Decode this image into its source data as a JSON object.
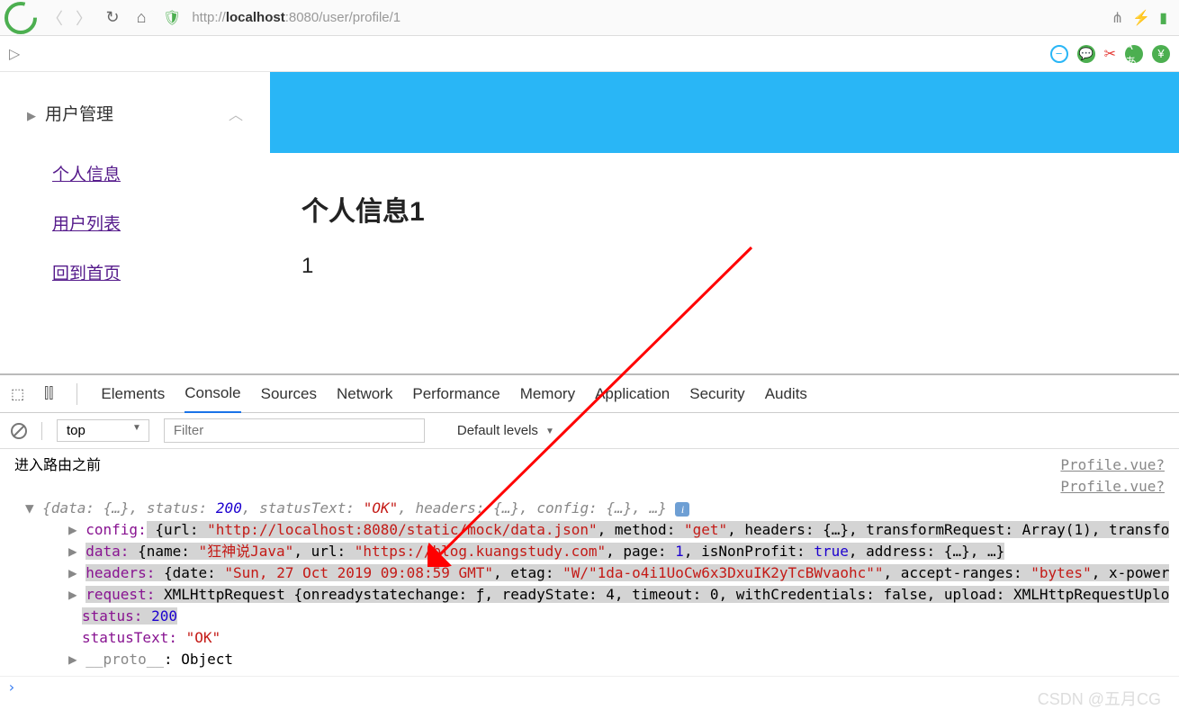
{
  "browser": {
    "url_host": "localhost",
    "url_port": ":8080",
    "url_path": "/user/profile/1"
  },
  "sidebar": {
    "header": "用户管理",
    "links": [
      "个人信息",
      "用户列表",
      "回到首页"
    ]
  },
  "main": {
    "title": "个人信息1",
    "value": "1"
  },
  "devtools": {
    "tabs": [
      "Elements",
      "Console",
      "Sources",
      "Network",
      "Performance",
      "Memory",
      "Application",
      "Security",
      "Audits"
    ],
    "active_tab": "Console",
    "context": "top",
    "filter_placeholder": "Filter",
    "levels": "Default levels"
  },
  "console": {
    "msg1": "进入路由之前",
    "source1": "Profile.vue?",
    "source2": "Profile.vue?",
    "summary_pre": "{data: {…}, status: ",
    "summary_status": "200",
    "summary_mid1": ", statusText: ",
    "summary_ok": "\"OK\"",
    "summary_rest": ", headers: {…}, config: {…}, …}",
    "config_key": "config:",
    "config_val_pre": " {url: ",
    "config_url": "\"http://localhost:8080/static/mock/data.json\"",
    "config_mid": ", method: ",
    "config_method": "\"get\"",
    "config_rest": ", headers: {…}, transformRequest: Array(1), transfo",
    "data_key": "data:",
    "data_val_pre": " {name: ",
    "data_name": "\"狂神说Java\"",
    "data_mid1": ", url: ",
    "data_url": "\"https://blog.kuangstudy.com\"",
    "data_mid2": ", page: ",
    "data_page": "1",
    "data_mid3": ", isNonProfit: ",
    "data_np": "true",
    "data_rest": ", address: {…}, …}",
    "headers_key": "headers:",
    "headers_pre": " {date: ",
    "headers_date": "\"Sun, 27 Oct 2019 09:08:59 GMT\"",
    "headers_mid": ", etag: ",
    "headers_etag": "\"W/\"1da-o4i1UoCw6x3DxuIK2yTcBWvaohc\"\"",
    "headers_rest": ", accept-ranges: ",
    "headers_bytes": "\"bytes\"",
    "headers_end": ", x-power",
    "request_key": "request:",
    "request_val": " XMLHttpRequest {onreadystatechange: ƒ, readyState: 4, timeout: 0, withCredentials: false, upload: XMLHttpRequestUplo",
    "status_key": "status:",
    "status_val": " 200",
    "statustext_key": "statusText:",
    "statustext_val": " \"OK\"",
    "proto_key": "__proto__",
    "proto_val": ": Object"
  },
  "watermark": "CSDN @五月CG"
}
